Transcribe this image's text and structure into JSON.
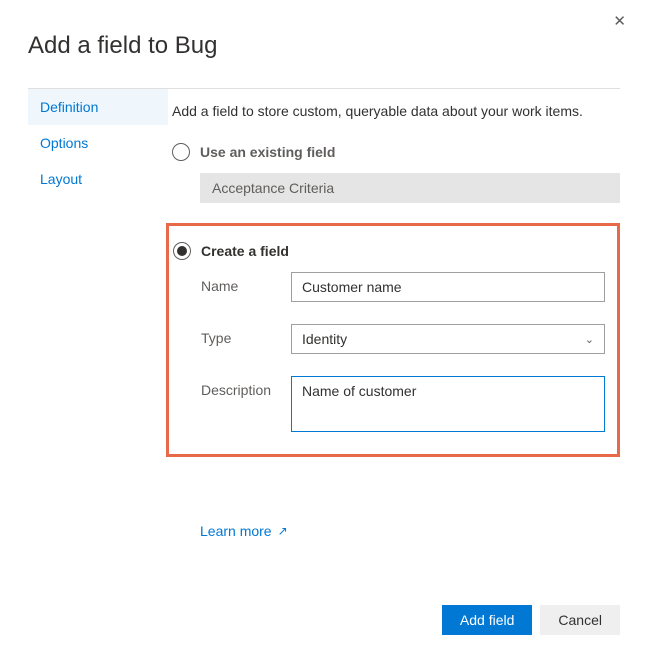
{
  "dialog": {
    "title": "Add a field to Bug",
    "intro": "Add a field to store custom, queryable data about your work items."
  },
  "sidebar": {
    "items": [
      {
        "label": "Definition",
        "selected": true
      },
      {
        "label": "Options",
        "selected": false
      },
      {
        "label": "Layout",
        "selected": false
      }
    ]
  },
  "existing": {
    "radio_label": "Use an existing field",
    "selected_value": "Acceptance Criteria"
  },
  "create": {
    "radio_label": "Create a field",
    "name_label": "Name",
    "name_value": "Customer name",
    "type_label": "Type",
    "type_value": "Identity",
    "description_label": "Description",
    "description_value": "Name of customer"
  },
  "learn_more": "Learn more",
  "buttons": {
    "primary": "Add field",
    "secondary": "Cancel"
  }
}
